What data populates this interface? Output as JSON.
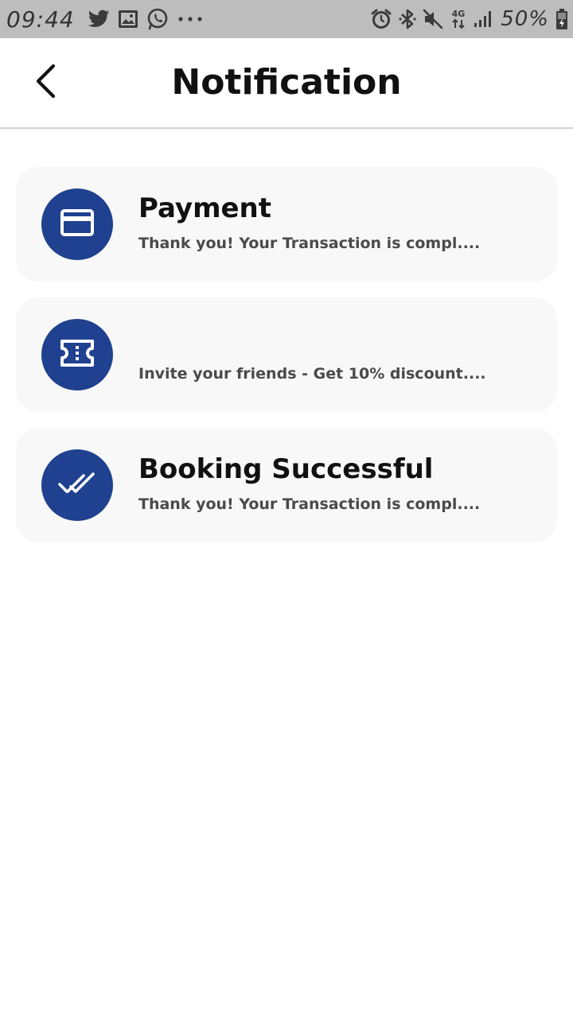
{
  "status_bar": {
    "time": "09:44",
    "battery_percent": "50%",
    "network_type": "4G",
    "left_icons": [
      "twitter-icon",
      "image-icon",
      "whatsapp-icon",
      "more-dots-icon"
    ],
    "right_icons": [
      "alarm-icon",
      "bluetooth-icon",
      "mute-icon",
      "network-4g-icon",
      "signal-icon",
      "battery-charging-icon"
    ]
  },
  "header": {
    "title": "Notification",
    "back_icon": "chevron-left-icon"
  },
  "notifications": [
    {
      "icon": "credit-card-icon",
      "title": "Payment",
      "message": "Thank you! Your Transaction is compl...."
    },
    {
      "icon": "ticket-icon",
      "title": "",
      "message": "Invite your friends - Get 10% discount...."
    },
    {
      "icon": "double-check-icon",
      "title": "Booking Successful",
      "message": "Thank you! Your Transaction is compl...."
    }
  ],
  "colors": {
    "accent": "#1f418f",
    "card_background": "#f8f8f8",
    "status_bar_background": "#bdbdbd",
    "title_text": "#111111",
    "message_text": "#4a4a4a"
  }
}
